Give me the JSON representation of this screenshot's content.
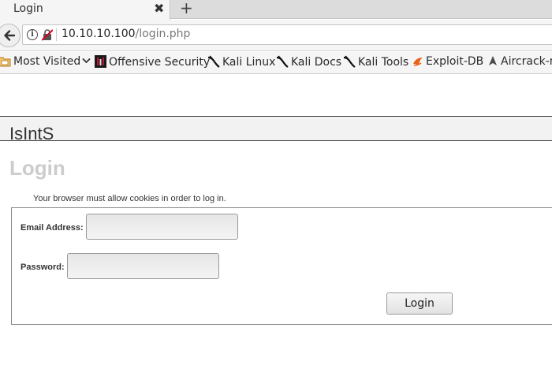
{
  "browser": {
    "tab": {
      "title": "Login",
      "close_icon": "close-icon"
    },
    "new_tab_symbol": "+",
    "url": {
      "host": "10.10.10.100",
      "path": "/login.php"
    },
    "bookmarks": [
      {
        "label": "Most Visited",
        "icon": "folder-icon"
      },
      {
        "label": "Offensive Security",
        "icon": "offsec-icon"
      },
      {
        "label": "Kali Linux",
        "icon": "kali-dragon-icon"
      },
      {
        "label": "Kali Docs",
        "icon": "kali-dragon-icon"
      },
      {
        "label": "Kali Tools",
        "icon": "kali-dragon-icon"
      },
      {
        "label": "Exploit-DB",
        "icon": "exploitdb-icon"
      },
      {
        "label": "Aircrack-ng",
        "icon": "aircrack-icon"
      }
    ]
  },
  "page": {
    "site_name": "IsIntS",
    "heading": "Login",
    "notice": "Your browser must allow cookies in order to log in.",
    "form": {
      "email_label": "Email Address:",
      "email_value": "",
      "password_label": "Password:",
      "password_value": "",
      "submit_label": "Login"
    }
  },
  "colors": {
    "heading": "#cccccc",
    "tab_bg": "#f5f5f5",
    "toolbar_bg": "#f5f5f5"
  }
}
